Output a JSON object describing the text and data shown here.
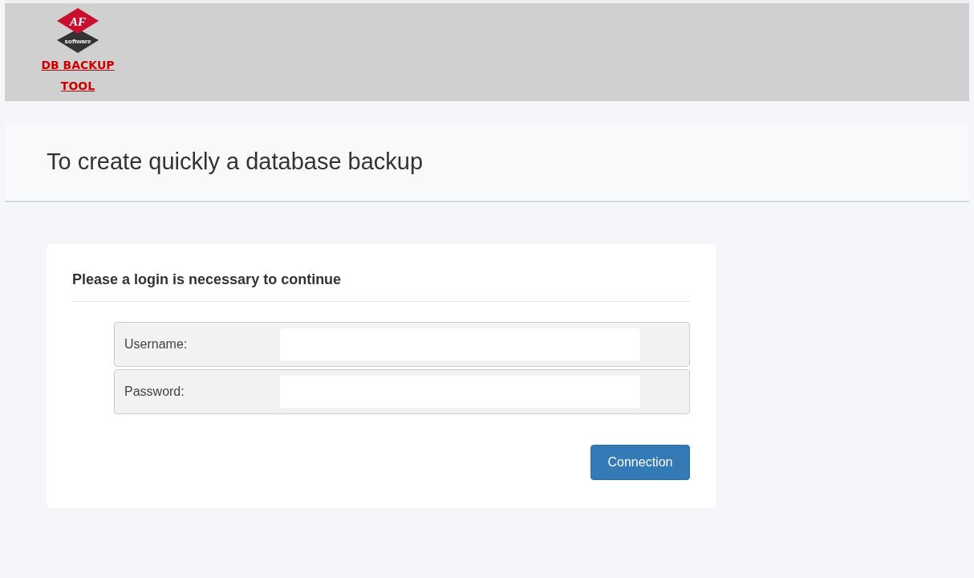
{
  "header": {
    "logo": {
      "mark": "AF",
      "tagline": "software"
    },
    "app_title_lines": [
      "DB BACKUP",
      "TOOL"
    ]
  },
  "banner": {
    "title": "To create quickly a database backup"
  },
  "login": {
    "heading": "Please a login is necessary to continue",
    "fields": [
      {
        "label": "Username:"
      },
      {
        "label": "Password:"
      }
    ],
    "button": "Connection"
  }
}
